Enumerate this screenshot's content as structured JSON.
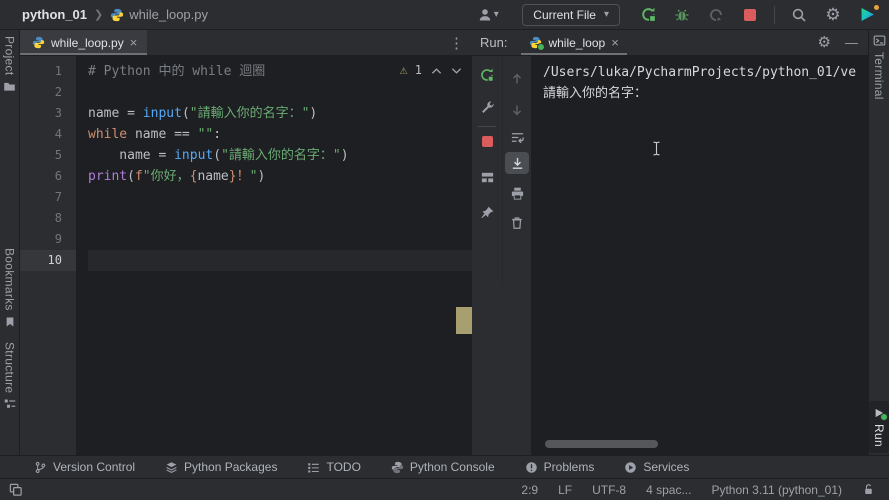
{
  "top_bar": {
    "breadcrumb_project": "python_01",
    "breadcrumb_file": "while_loop.py",
    "run_config_selector": "Current File",
    "caret": "▾"
  },
  "tool_strips": {
    "left": [
      "Project",
      "Bookmarks",
      "Structure"
    ],
    "right_top": "Terminal",
    "right_bottom": "Run"
  },
  "editor": {
    "tab_title": "while_loop.py",
    "tab_close": "×",
    "kebab": "⋮",
    "warning_icon": "⚠",
    "warning_count": "1",
    "current_line": 10,
    "lines": [
      {
        "num": "1",
        "segments": [
          {
            "t": "# Python 中的 while 迴圈",
            "c": "comment"
          }
        ]
      },
      {
        "num": "2",
        "segments": []
      },
      {
        "num": "3",
        "segments": [
          {
            "t": "name = ",
            "c": "plain"
          },
          {
            "t": "input",
            "c": "func"
          },
          {
            "t": "(",
            "c": "plain"
          },
          {
            "t": "\"請輸入你的名字：\"",
            "c": "str"
          },
          {
            "t": ")",
            "c": "plain"
          }
        ]
      },
      {
        "num": "4",
        "segments": [
          {
            "t": "while ",
            "c": "kw"
          },
          {
            "t": "name == ",
            "c": "plain"
          },
          {
            "t": "\"\"",
            "c": "str"
          },
          {
            "t": ":",
            "c": "plain"
          }
        ]
      },
      {
        "num": "5",
        "segments": [
          {
            "t": "    name = ",
            "c": "plain"
          },
          {
            "t": "input",
            "c": "func"
          },
          {
            "t": "(",
            "c": "plain"
          },
          {
            "t": "\"請輸入你的名字：\"",
            "c": "str"
          },
          {
            "t": ")",
            "c": "plain"
          }
        ]
      },
      {
        "num": "6",
        "segments": [
          {
            "t": "print",
            "c": "builtin"
          },
          {
            "t": "(",
            "c": "plain"
          },
          {
            "t": "f",
            "c": "kw"
          },
          {
            "t": "\"你好，",
            "c": "str"
          },
          {
            "t": "{",
            "c": "brace"
          },
          {
            "t": "name",
            "c": "plain"
          },
          {
            "t": "}",
            "c": "brace"
          },
          {
            "t": "！",
            "c": "kw"
          },
          {
            "t": "\"",
            "c": "str"
          },
          {
            "t": ")",
            "c": "plain"
          }
        ]
      },
      {
        "num": "7",
        "segments": []
      },
      {
        "num": "8",
        "segments": []
      },
      {
        "num": "9",
        "segments": []
      },
      {
        "num": "10",
        "segments": []
      }
    ]
  },
  "run_panel": {
    "label": "Run:",
    "tab_title": "while_loop",
    "tab_close": "×",
    "minimize": "—",
    "console_lines": [
      "/Users/luka/PycharmProjects/python_01/ve",
      "請輸入你的名字："
    ]
  },
  "bottom_bar": [
    "Version Control",
    "Python Packages",
    "TODO",
    "Python Console",
    "Problems",
    "Services"
  ],
  "status_bar": {
    "caret_position": "2:9",
    "line_separator": "LF",
    "encoding": "UTF-8",
    "indent": "4 spac...",
    "interpreter": "Python 3.11 (python_01)"
  },
  "colors": {
    "panel_bg": "#2b2d30",
    "editor_bg": "#1e1f22",
    "accent_green": "#57965c",
    "stop_red": "#db5c5c",
    "warning_tan": "#a8a06b",
    "stripe_mark_tan": "#a89f70",
    "string_green": "#6aab73",
    "keyword_orange": "#cf8e6d",
    "function_blue": "#56a8f5",
    "builtin_purple": "#b07bd8",
    "comment_gray": "#7a7e85"
  }
}
